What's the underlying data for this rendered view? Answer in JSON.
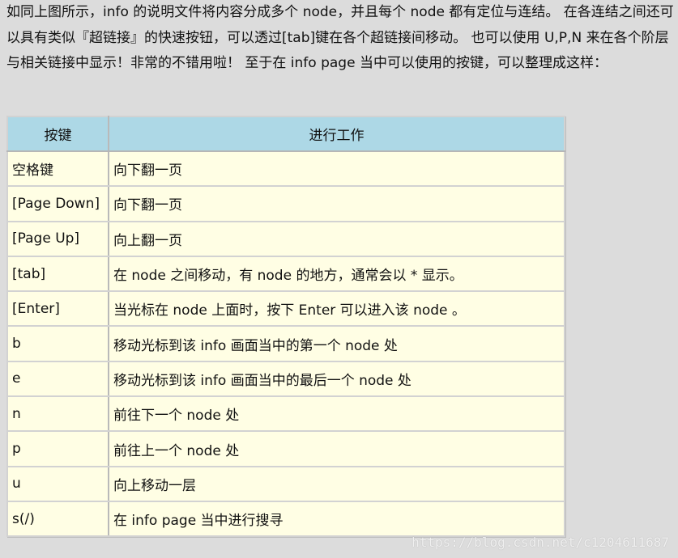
{
  "intro": {
    "text": "如同上图所示，info 的说明文件将内容分成多个 node，并且每个 node 都有定位与连结。 在各连结之间还可以具有类似『超链接』的快速按钮，可以透过[tab]键在各个超链接间移动。 也可以使用 U,P,N 来在各个阶层与相关链接中显示！非常的不错用啦！ 至于在 info page 当中可以使用的按键，可以整理成这样："
  },
  "table": {
    "headers": [
      "按键",
      "进行工作"
    ],
    "rows": [
      {
        "key": "空格键",
        "action": "向下翻一页"
      },
      {
        "key": "[Page Down]",
        "action": "向下翻一页"
      },
      {
        "key": "[Page Up]",
        "action": "向上翻一页"
      },
      {
        "key": "[tab]",
        "action": "在 node 之间移动，有 node 的地方，通常会以 * 显示。"
      },
      {
        "key": "[Enter]",
        "action": "当光标在 node 上面时，按下 Enter 可以进入该 node 。"
      },
      {
        "key": "b",
        "action": "移动光标到该 info 画面当中的第一个 node 处"
      },
      {
        "key": "e",
        "action": "移动光标到该 info 画面当中的最后一个 node 处"
      },
      {
        "key": "n",
        "action": "前往下一个 node 处"
      },
      {
        "key": "p",
        "action": "前往上一个 node 处"
      },
      {
        "key": "u",
        "action": "向上移动一层"
      },
      {
        "key": "s(/)",
        "action": "在 info page 当中进行搜寻"
      }
    ]
  },
  "watermark": "https://blog.csdn.net/c1204611687"
}
